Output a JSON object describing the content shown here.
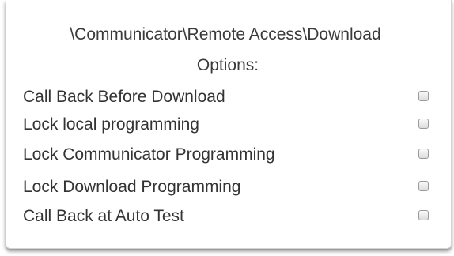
{
  "panel": {
    "title_line1": "\\Communicator\\Remote Access\\Download",
    "title_line2": "Options:"
  },
  "options": [
    {
      "label": "Call Back Before Download",
      "checked": false
    },
    {
      "label": "Lock local programming",
      "checked": false
    },
    {
      "label": "Lock Communicator Programming",
      "checked": false
    },
    {
      "label": "Lock Download Programming",
      "checked": false
    },
    {
      "label": "Call Back at Auto Test",
      "checked": false
    }
  ]
}
